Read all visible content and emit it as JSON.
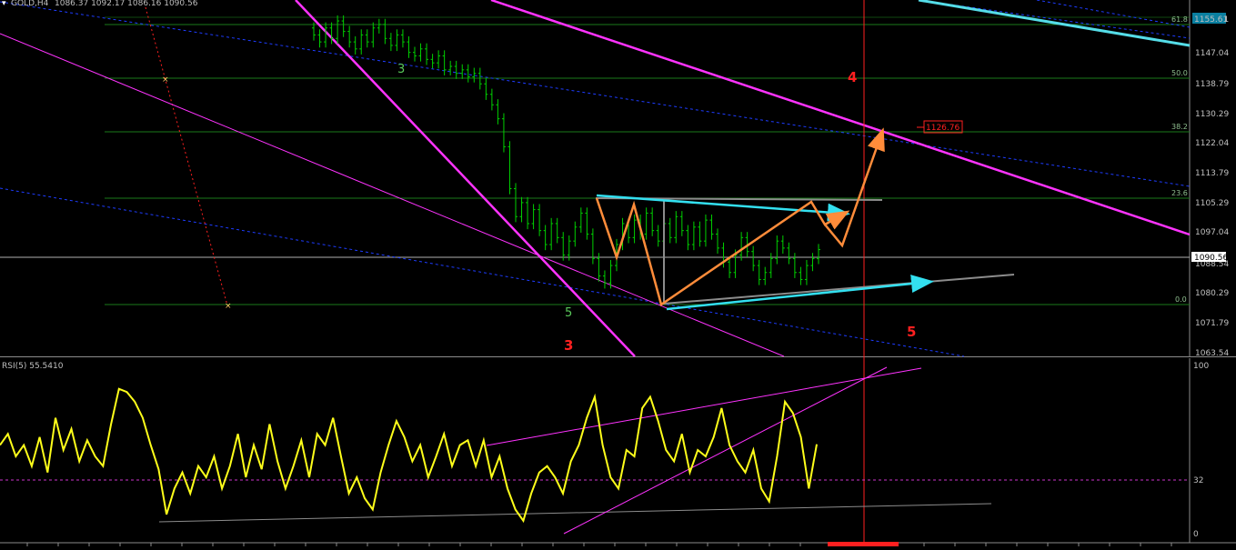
{
  "header": {
    "symbol": "GOLD,H4",
    "ohlc": "1086.37 1092.17 1086.16 1090.56"
  },
  "price_axis": {
    "ticks": [
      "1155.61",
      "1147.04",
      "1138.79",
      "1130.29",
      "1122.04",
      "1113.79",
      "1105.29",
      "1097.04",
      "1088.54",
      "1080.29",
      "1071.79",
      "1063.54"
    ],
    "current_price": "1090.56",
    "target_price": "1126.76"
  },
  "fib_levels": [
    "61.8",
    "50.0",
    "38.2",
    "23.6",
    "0.0"
  ],
  "wave_labels": {
    "green": [
      "3",
      "5"
    ],
    "red": [
      "4",
      "3",
      "5"
    ]
  },
  "rsi": {
    "title": "RSI(5) 55.5410",
    "ticks": [
      "100",
      "32",
      "0"
    ]
  },
  "colors": {
    "background": "#000000",
    "candle": "#00d000",
    "channel": "#ff33ff",
    "trend_blue": "#1e3cff",
    "projection": "#ff8c3a",
    "trendline": "#33e0f0",
    "fib": "#1a7a1a",
    "rsi_line": "#ffff1a",
    "marker": "#ff2020"
  },
  "chart_data": [
    {
      "type": "ohlc",
      "title": "GOLD,H4",
      "series": [
        {
          "name": "GOLD,H4",
          "close": [
            1152,
            1150,
            1154,
            1151,
            1156,
            1153,
            1150,
            1148,
            1152,
            1150,
            1154,
            1155,
            1151,
            1149,
            1152,
            1150,
            1147,
            1146,
            1148,
            1145,
            1144,
            1146,
            1142,
            1143,
            1141,
            1142,
            1140,
            1141,
            1138,
            1135,
            1132,
            1128,
            1120,
            1108,
            1100,
            1104,
            1098,
            1102,
            1096,
            1092,
            1098,
            1094,
            1089,
            1093,
            1097,
            1101,
            1095,
            1088,
            1083,
            1081,
            1086,
            1092,
            1098,
            1094,
            1099,
            1095,
            1101,
            1096,
            1093,
            1098,
            1094,
            1100,
            1096,
            1092,
            1097,
            1093,
            1099,
            1095,
            1091,
            1087,
            1084,
            1089,
            1094,
            1090,
            1086,
            1082,
            1084,
            1088,
            1093,
            1091,
            1088,
            1084,
            1082,
            1086,
            1088,
            1090.56
          ]
        }
      ],
      "ylim": [
        1060,
        1162
      ],
      "annotations": {
        "target": 1126.76,
        "current": 1090.56
      }
    },
    {
      "type": "line",
      "title": "RSI(5) 55.5410",
      "series": [
        {
          "name": "RSI(5) 55.5410",
          "values": [
            55,
            62,
            48,
            55,
            42,
            60,
            38,
            72,
            52,
            65,
            45,
            58,
            48,
            42,
            68,
            90,
            88,
            82,
            72,
            55,
            40,
            12,
            28,
            38,
            25,
            42,
            35,
            48,
            28,
            42,
            62,
            35,
            55,
            40,
            68,
            45,
            28,
            42,
            58,
            35,
            62,
            55,
            72,
            48,
            25,
            35,
            22,
            15,
            38,
            55,
            70,
            60,
            45,
            55,
            35,
            48,
            62,
            42,
            55,
            58,
            42,
            58,
            35,
            48,
            28,
            15,
            8,
            25,
            38,
            42,
            35,
            25,
            45,
            55,
            72,
            85,
            55,
            35,
            28,
            52,
            48,
            78,
            85,
            70,
            52,
            45,
            62,
            38,
            52,
            48,
            60,
            78,
            55,
            45,
            38,
            52,
            28,
            20,
            48,
            82,
            75,
            60,
            28,
            55.54
          ],
          "ylim": [
            0,
            100
          ]
        }
      ],
      "levels": [
        32
      ]
    }
  ]
}
